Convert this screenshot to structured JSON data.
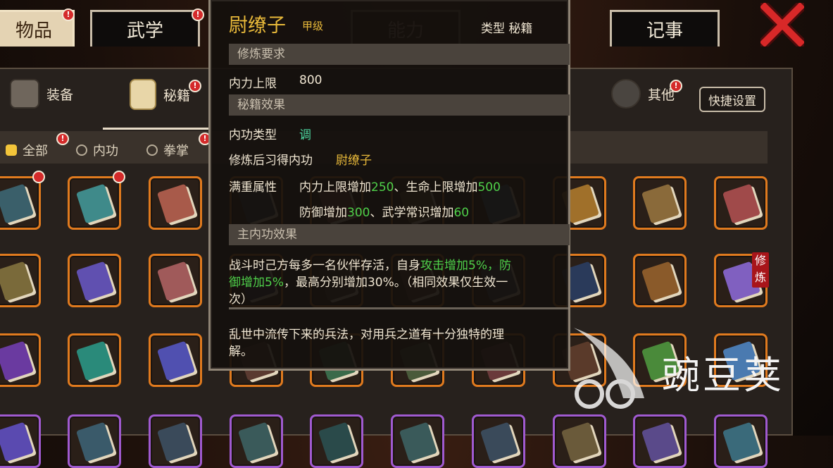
{
  "top_tabs": [
    {
      "label": "物品",
      "active": true,
      "badge": "!"
    },
    {
      "label": "武学",
      "active": false,
      "badge": "!"
    },
    {
      "label": "能力",
      "active": false
    },
    {
      "label": "记事",
      "active": false
    }
  ],
  "categories": [
    {
      "label": "装备",
      "icon": "armor-icon"
    },
    {
      "label": "秘籍",
      "icon": "scroll-book-icon",
      "active": true,
      "badge": "!"
    },
    {
      "label": "其他",
      "icon": "misc-icon",
      "badge": "!"
    }
  ],
  "shortcut_button": "快捷设置",
  "filters": [
    {
      "label": "全部",
      "checked": true,
      "badge": "!"
    },
    {
      "label": "内功",
      "checked": false
    },
    {
      "label": "拳掌",
      "checked": false,
      "badge": "!"
    }
  ],
  "cultivate_tag": "修炼",
  "tooltip": {
    "title": "尉缭子",
    "grade": "甲级",
    "type_line": "类型  秘籍",
    "req_header": "修炼要求",
    "req_label": "内力上限",
    "req_value": "800",
    "effect_header": "秘籍效果",
    "internal_type_label": "内功类型",
    "internal_type_value": "调",
    "learn_label": "修炼后习得内功",
    "learn_value": "尉缭子",
    "full_attr_label": "满重属性",
    "attr1_text": "内力上限增加",
    "attr1_val": "250",
    "attr2_text": "、生命上限增加",
    "attr2_val": "500",
    "attr3_text": "防御增加",
    "attr3_val": "300",
    "attr4_text": "、武学常识增加",
    "attr4_val": "60",
    "main_effect_header": "主内功效果",
    "main_effect_a": "战斗时己方每多一名伙伴存活，自身",
    "main_effect_b": "攻击增加5%，防",
    "main_effect_c": "御增加5%",
    "main_effect_d": "，最高分别增加30%。（相同效果仅生效一",
    "main_effect_e": "次）",
    "desc_line1": "乱世中流传下来的兵法，对用兵之道有十分独特的理",
    "desc_line2": "解。"
  },
  "watermark": "豌豆荚",
  "colors": {
    "orange_border": "#e07a1e",
    "purple_border": "#a05ad0",
    "badge_red": "#d42a2a",
    "title_gold": "#e8b93a",
    "stat_green": "#4fd14a"
  }
}
